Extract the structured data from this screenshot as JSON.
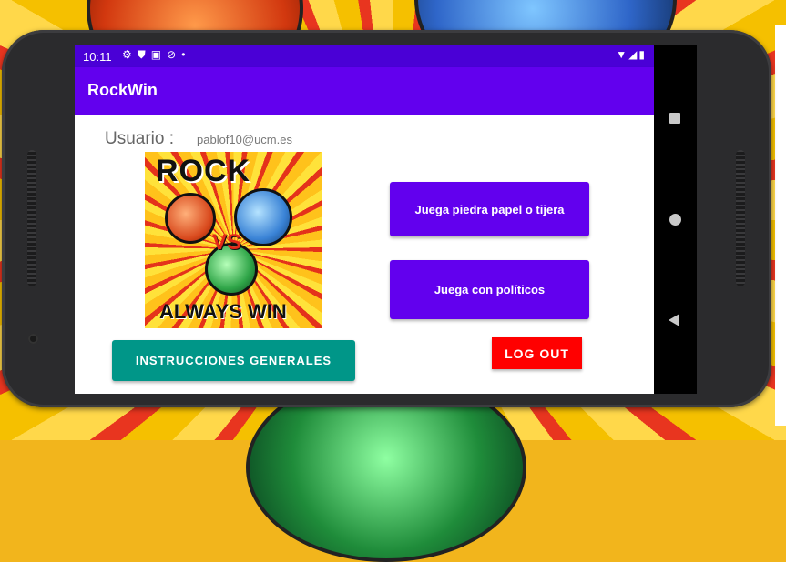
{
  "status_bar": {
    "time": "10:11",
    "left_icons": [
      "gear-icon",
      "shield-icon",
      "sim-icon",
      "no-disturb-icon",
      "dot-icon"
    ],
    "right_icons": [
      "wifi-icon",
      "signal-icon",
      "battery-icon"
    ]
  },
  "app_bar": {
    "title": "RockWin"
  },
  "user": {
    "label": "Usuario :",
    "email": "pablof10@ucm.es"
  },
  "logo": {
    "top_text": "ROCK",
    "vs_text": "VS",
    "bottom_text": "ALWAYS WIN"
  },
  "buttons": {
    "rps": "Juega piedra papel o tijera",
    "politicians": "Juega con políticos",
    "logout": "LOG OUT",
    "instructions": "INSTRUCCIONES GENERALES"
  },
  "colors": {
    "primary": "#6200ee",
    "status_bar": "#4a00d6",
    "logout": "#ff0000",
    "instructions": "#009688"
  }
}
